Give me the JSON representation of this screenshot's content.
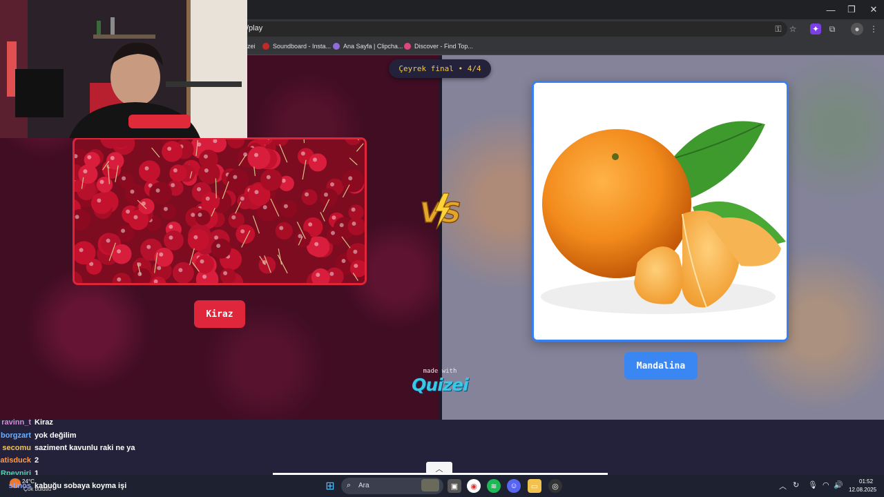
{
  "browser": {
    "url": "/play",
    "bookmarks": [
      {
        "label": "zei",
        "color": "#888888"
      },
      {
        "label": "Soundboard - Insta...",
        "color": "#c62828"
      },
      {
        "label": "Ana Sayfa | Clipcha...",
        "color": "#8e6bd6"
      },
      {
        "label": "Discover - Find Top...",
        "color": "#e0457b"
      }
    ]
  },
  "game": {
    "round_label": "Çeyrek final • 4/4",
    "left_option": {
      "label": "Kiraz"
    },
    "right_option": {
      "label": "Mandalina"
    },
    "made_with": "made with",
    "brand": "Quizei"
  },
  "chat": {
    "messages": [
      {
        "user": "ravinn_t",
        "color": "#d98bd6",
        "text": "Kiraz"
      },
      {
        "user": "borgzart",
        "color": "#6db0ff",
        "text": "yok değilim"
      },
      {
        "user": "secomu",
        "color": "#f2c45a",
        "text": "saziment kavunlu raki ne ya"
      },
      {
        "user": "atisduck",
        "color": "#ff9a4d",
        "text": "2"
      },
      {
        "user": "Rpeyniri",
        "color": "#4fd6b0",
        "text": "1"
      },
      {
        "user": "stinos",
        "color": "#8aa6ff",
        "text": "kabuğu sobaya koyma işi"
      }
    ]
  },
  "taskbar": {
    "search_placeholder": "Ara",
    "weather_temp": "24°C",
    "weather_desc": "Çok bulutlu",
    "time": "01:52",
    "date": "12.08.2025"
  }
}
